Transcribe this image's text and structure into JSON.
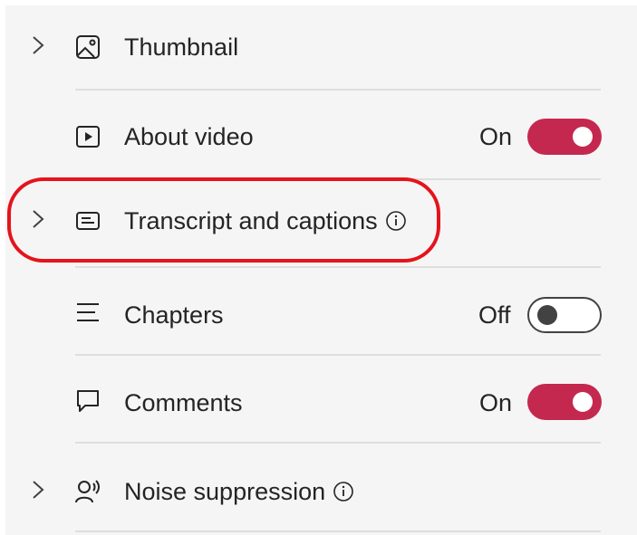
{
  "settings": {
    "items": [
      {
        "id": "thumbnail",
        "label": "Thumbnail",
        "expandable": true,
        "icon": "image-icon"
      },
      {
        "id": "about-video",
        "label": "About video",
        "expandable": false,
        "icon": "video-play-icon",
        "state_text": "On",
        "toggle_on": true
      },
      {
        "id": "transcript",
        "label": "Transcript and captions",
        "expandable": true,
        "icon": "captions-icon",
        "info": true
      },
      {
        "id": "chapters",
        "label": "Chapters",
        "expandable": false,
        "icon": "list-lines-icon",
        "state_text": "Off",
        "toggle_on": false
      },
      {
        "id": "comments",
        "label": "Comments",
        "expandable": false,
        "icon": "comment-icon",
        "state_text": "On",
        "toggle_on": true
      },
      {
        "id": "noise",
        "label": "Noise suppression",
        "expandable": true,
        "icon": "voice-icon",
        "info": true
      }
    ]
  },
  "colors": {
    "panel_bg": "#f5f5f5",
    "toggle_on": "#c4284f",
    "highlight": "#e5131b",
    "text": "#242424"
  }
}
